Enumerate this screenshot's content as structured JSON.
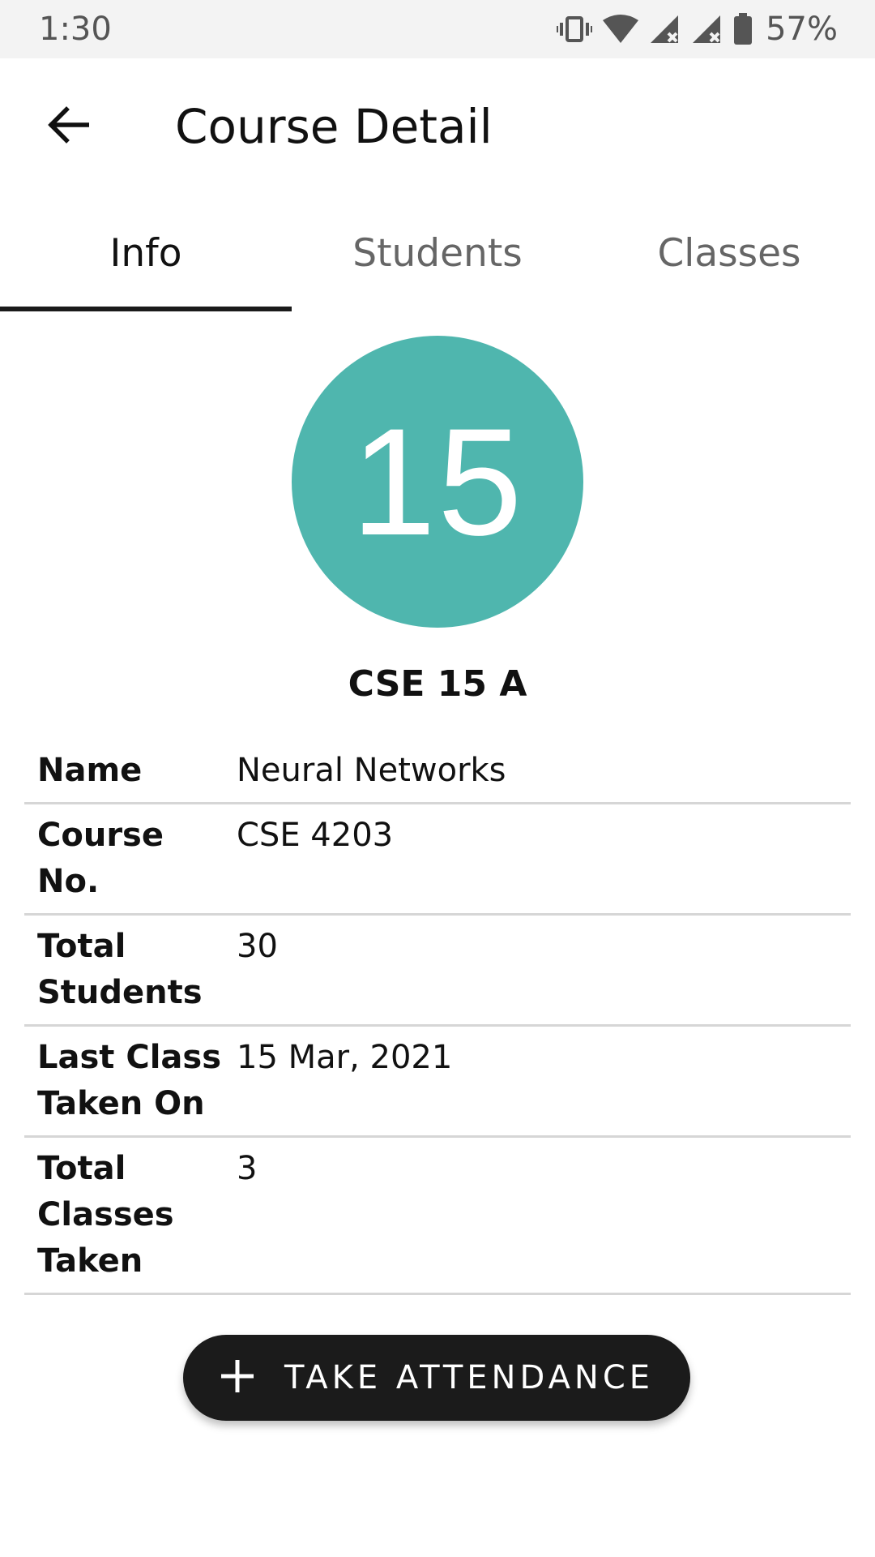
{
  "status_bar": {
    "time": "1:30",
    "battery": "57%",
    "icons": [
      "vibrate-icon",
      "wifi-icon",
      "signal-icon",
      "signal-icon",
      "battery-icon"
    ]
  },
  "app_bar": {
    "title": "Course Detail",
    "back_icon": "arrow-back-icon"
  },
  "tabs": [
    {
      "label": "Info",
      "active": true
    },
    {
      "label": "Students",
      "active": false
    },
    {
      "label": "Classes",
      "active": false
    }
  ],
  "course": {
    "badge_number": "15",
    "badge_color": "#4fb6ae",
    "code": "CSE 15 A"
  },
  "details": [
    {
      "label": "Name",
      "value": "Neural Networks"
    },
    {
      "label": "Course No.",
      "value": "CSE 4203"
    },
    {
      "label": "Total Students",
      "value": "30"
    },
    {
      "label": "Last Class Taken On",
      "value": "15 Mar, 2021"
    },
    {
      "label": "Total Classes Taken",
      "value": "3"
    }
  ],
  "action": {
    "label": "TAKE ATTENDANCE",
    "icon": "plus-icon"
  }
}
